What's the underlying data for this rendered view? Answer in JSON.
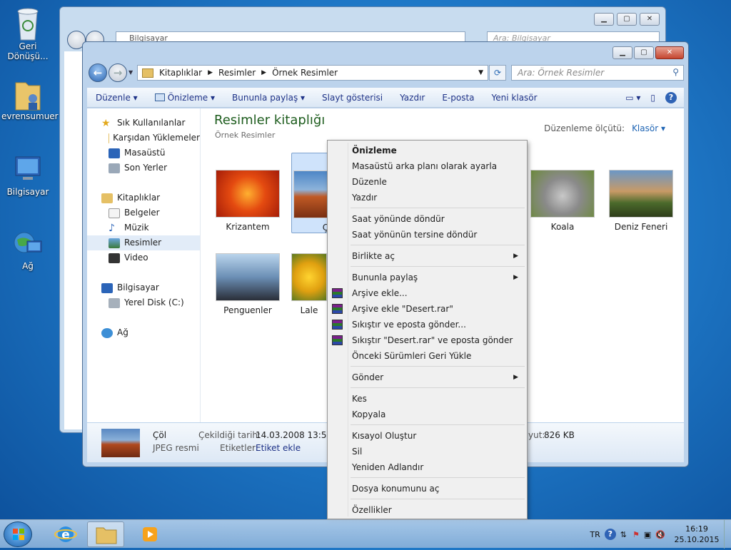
{
  "desktop": {
    "icons": [
      {
        "label": "Geri Dönüşü...",
        "icon": "recycle-bin-icon"
      },
      {
        "label": "evrensumuer",
        "icon": "user-folder-icon"
      },
      {
        "label": "Bilgisayar",
        "icon": "computer-icon"
      },
      {
        "label": "Ağ",
        "icon": "network-icon"
      }
    ]
  },
  "bg_window": {
    "address": "Bilgisayar",
    "search_placeholder": "Ara: Bilgisayar"
  },
  "window": {
    "breadcrumb": [
      "Kitaplıklar",
      "Resimler",
      "Örnek Resimler"
    ],
    "search_placeholder": "Ara: Örnek Resimler",
    "toolbar": {
      "organize": "Düzenle",
      "preview": "Önizleme",
      "share": "Bununla paylaş",
      "slideshow": "Slayt gösterisi",
      "print": "Yazdır",
      "email": "E-posta",
      "new_folder": "Yeni klasör"
    },
    "sidebar": {
      "favorites": "Sık Kullanılanlar",
      "downloads": "Karşıdan Yüklemeler",
      "desktop": "Masaüstü",
      "recent": "Son Yerler",
      "libraries": "Kitaplıklar",
      "documents": "Belgeler",
      "music": "Müzik",
      "pictures": "Resimler",
      "video": "Video",
      "computer": "Bilgisayar",
      "local_disk": "Yerel Disk (C:)",
      "network": "Ağ"
    },
    "main": {
      "title": "Resimler kitaplığı",
      "subtitle": "Örnek Resimler",
      "arrange_label": "Düzenleme ölçütü:",
      "arrange_value": "Klasör",
      "thumbnails": [
        {
          "label": "Krizantem"
        },
        {
          "label": "Ç"
        },
        {
          "label": "Koala"
        },
        {
          "label": "Deniz Feneri"
        },
        {
          "label": "Penguenler"
        },
        {
          "label": "Lale"
        }
      ]
    },
    "details": {
      "name": "Çöl",
      "type": "JPEG resmi",
      "date_label": "Çekildiği tarih:",
      "date_value": "14.03.2008 13:59",
      "tags_label": "Etiketler:",
      "tags_value": "Etiket ekle",
      "size_label": "yut:",
      "size_value": "826 KB"
    }
  },
  "context_menu": {
    "items": [
      "Önizleme",
      "Masaüstü arka planı olarak ayarla",
      "Düzenle",
      "Yazdır",
      "Saat yönünde döndür",
      "Saat yönünün tersine döndür",
      "Birlikte aç",
      "Bununla paylaş",
      "Arşive ekle...",
      "Arşive ekle \"Desert.rar\"",
      "Sıkıştır ve eposta gönder...",
      "Sıkıştır \"Desert.rar\" ve eposta gönder",
      "Önceki Sürümleri Geri Yükle",
      "Gönder",
      "Kes",
      "Kopyala",
      "Kısayol Oluştur",
      "Sil",
      "Yeniden Adlandır",
      "Dosya konumunu aç",
      "Özellikler"
    ]
  },
  "taskbar": {
    "language": "TR",
    "time": "16:19",
    "date": "25.10.2015"
  }
}
